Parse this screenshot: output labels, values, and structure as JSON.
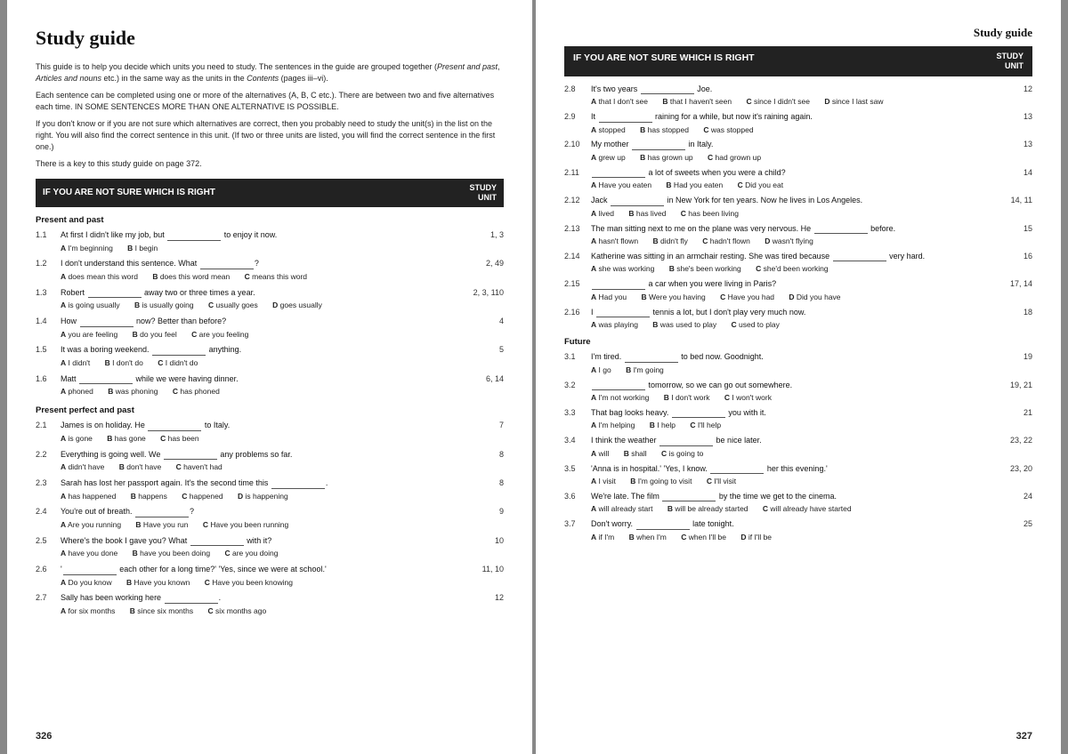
{
  "left_page": {
    "title": "Study guide",
    "intro1": "This guide is to help you decide which units you need to study.  The sentences in the guide are grouped together (Present and past, Articles and nouns etc.) in the same way as the units in the Contents (pages iii–vi).",
    "intro2": "Each sentence can be completed using one or more of the alternatives (A, B, C etc.).  There are between two and five alternatives each time.  IN SOME SENTENCES MORE THAN ONE ALTERNATIVE IS POSSIBLE.",
    "intro3": "If you don't know or if you are not sure which alternatives are correct, then you probably need to study the unit(s) in the list on the right.  You will also find the correct sentence in this unit.  (If two or three units are listed, you will find the correct sentence in the first one.)",
    "intro4": "There is a key to this study guide on page 372.",
    "header_text": "IF YOU ARE NOT SURE WHICH IS RIGHT",
    "study_unit_label": "STUDY\nUNIT",
    "present_past_heading": "Present and past",
    "present_perfect_heading": "Present perfect and past",
    "exercises": [
      {
        "num": "1.1",
        "sentence": "At first I didn't like my job, but _____________ to enjoy it now.",
        "options": [
          "A I'm beginning",
          "B I begin"
        ],
        "unit": "1, 3"
      },
      {
        "num": "1.2",
        "sentence": "I don't understand this sentence.  What _____________?",
        "options": [
          "A does mean this word",
          "B does this word mean",
          "C means this word"
        ],
        "unit": "2, 49"
      },
      {
        "num": "1.3",
        "sentence": "Robert _____________ away two or three times a year.",
        "options": [
          "A is going usually",
          "B is usually going",
          "C usually goes",
          "D goes usually"
        ],
        "unit": "2, 3, 110"
      },
      {
        "num": "1.4",
        "sentence": "How _____________ now?  Better than before?",
        "options": [
          "A you are feeling",
          "B do you feel",
          "C are you feeling"
        ],
        "unit": "4"
      },
      {
        "num": "1.5",
        "sentence": "It was a boring weekend. _____________ anything.",
        "options": [
          "A I didn't",
          "B I don't do",
          "C I didn't do"
        ],
        "unit": "5"
      },
      {
        "num": "1.6",
        "sentence": "Matt _____________ while we were having dinner.",
        "options": [
          "A phoned",
          "B was phoning",
          "C has phoned"
        ],
        "unit": "6, 14"
      },
      {
        "num": "2.1",
        "sentence": "James is on holiday.  He _____________ to Italy.",
        "options": [
          "A is gone",
          "B has gone",
          "C has been"
        ],
        "unit": "7"
      },
      {
        "num": "2.2",
        "sentence": "Everything is going well.  We _____________ any problems so far.",
        "options": [
          "A didn't have",
          "B don't have",
          "C haven't had"
        ],
        "unit": "8"
      },
      {
        "num": "2.3",
        "sentence": "Sarah has lost her passport again.  It's the second time this _____________.",
        "options": [
          "A has happened",
          "B happens",
          "C happened",
          "D is happening"
        ],
        "unit": "8"
      },
      {
        "num": "2.4",
        "sentence": "You're out of breath. _____________?",
        "options": [
          "A Are you running",
          "B Have you run",
          "C Have you been running"
        ],
        "unit": "9"
      },
      {
        "num": "2.5",
        "sentence": "Where's the book I gave you?  What _____________ with it?",
        "options": [
          "A have you done",
          "B have you been doing",
          "C are you doing"
        ],
        "unit": "10"
      },
      {
        "num": "2.6",
        "sentence": "' _____________ each other for a long time?'  'Yes, since we were at school.'",
        "options": [
          "A Do you know",
          "B Have you known",
          "C Have you been knowing"
        ],
        "unit": "11, 10"
      },
      {
        "num": "2.7",
        "sentence": "Sally has been working here _____________.",
        "options": [
          "A for six months",
          "B since six months",
          "C six months ago"
        ],
        "unit": "12"
      }
    ],
    "page_num": "326"
  },
  "right_page": {
    "study_guide_label": "Study guide",
    "header_text": "IF YOU ARE NOT SURE WHICH IS RIGHT",
    "study_unit_label": "STUDY\nUNIT",
    "exercises": [
      {
        "num": "2.8",
        "sentence": "It's two years _____________ Joe.",
        "options": [
          "A that I don't see",
          "B that I haven't seen",
          "C since I didn't see",
          "D since I last saw"
        ],
        "unit": "12"
      },
      {
        "num": "2.9",
        "sentence": "It _____________ raining for a while, but now it's raining again.",
        "options": [
          "A stopped",
          "B has stopped",
          "C was stopped"
        ],
        "unit": "13"
      },
      {
        "num": "2.10",
        "sentence": "My mother _____________ in Italy.",
        "options": [
          "A grew up",
          "B has grown up",
          "C had grown up"
        ],
        "unit": "13"
      },
      {
        "num": "2.11",
        "sentence": "_____________ a lot of sweets when you were a child?",
        "options": [
          "A Have you eaten",
          "B Had you eaten",
          "C Did you eat"
        ],
        "unit": "14"
      },
      {
        "num": "2.12",
        "sentence": "Jack _____________ in New York for ten years.  Now he lives in Los Angeles.",
        "options": [
          "A lived",
          "B has lived",
          "C has been living"
        ],
        "unit": "14, 11"
      },
      {
        "num": "2.13",
        "sentence": "The man sitting next to me on the plane was very nervous.  He _____________ before.",
        "options": [
          "A hasn't flown",
          "B didn't fly",
          "C hadn't flown",
          "D wasn't flying"
        ],
        "unit": "15"
      },
      {
        "num": "2.14",
        "sentence": "Katherine was sitting in an armchair resting.  She was tired because _____________ very hard.",
        "options": [
          "A she was working",
          "B she's been working",
          "C she'd been working"
        ],
        "unit": "16"
      },
      {
        "num": "2.15",
        "sentence": "_____________ a car when you were living in Paris?",
        "options": [
          "A Had you",
          "B Were you having",
          "C Have you had",
          "D Did you have"
        ],
        "unit": "17, 14"
      },
      {
        "num": "2.16",
        "sentence": "I _____________ tennis a lot, but I don't play very much now.",
        "options": [
          "A was playing",
          "B was used to play",
          "C used to play"
        ],
        "unit": "18"
      }
    ],
    "future_heading": "Future",
    "future_exercises": [
      {
        "num": "3.1",
        "sentence": "I'm tired. _____________ to bed now.  Goodnight.",
        "options": [
          "A I go",
          "B I'm going"
        ],
        "unit": "19"
      },
      {
        "num": "3.2",
        "sentence": "_____________ tomorrow, so we can go out somewhere.",
        "options": [
          "A I'm not working",
          "B I don't work",
          "C I won't work"
        ],
        "unit": "19, 21"
      },
      {
        "num": "3.3",
        "sentence": "That bag looks heavy. _____________ you with it.",
        "options": [
          "A I'm helping",
          "B I help",
          "C I'll help"
        ],
        "unit": "21"
      },
      {
        "num": "3.4",
        "sentence": "I think the weather _____________ be nice later.",
        "options": [
          "A will",
          "B shall",
          "C is going to"
        ],
        "unit": "23, 22"
      },
      {
        "num": "3.5",
        "sentence": "'Anna is in hospital.'  'Yes, I know. _____________ her this evening.'",
        "options": [
          "A I visit",
          "B I'm going to visit",
          "C I'll visit"
        ],
        "unit": "23, 20"
      },
      {
        "num": "3.6",
        "sentence": "We're late.  The film _____________ by the time we get to the cinema.",
        "options": [
          "A will already start",
          "B will be already started",
          "C will already have started"
        ],
        "unit": "24"
      },
      {
        "num": "3.7",
        "sentence": "Don't worry. _____________ late tonight.",
        "options": [
          "A if I'm",
          "B when I'm",
          "C when I'll be",
          "D if I'll be"
        ],
        "unit": "25"
      }
    ],
    "page_num": "327"
  }
}
